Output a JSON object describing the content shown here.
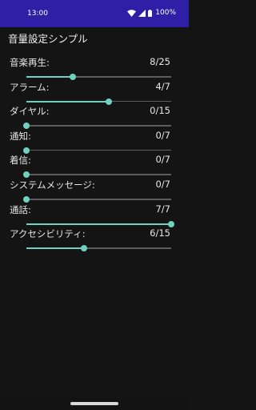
{
  "status_bar": {
    "time": "13:00",
    "battery": "100%",
    "icons": [
      "wifi-icon",
      "signal-icon",
      "battery-icon"
    ],
    "background": "#2e1fa6"
  },
  "app": {
    "title": "音量設定シンプル"
  },
  "accent_color": "#6fd1be",
  "volumes": [
    {
      "label": "音楽再生:",
      "value_text": "8/25",
      "current": 8,
      "max": 25
    },
    {
      "label": "アラーム:",
      "value_text": "4/7",
      "current": 4,
      "max": 7
    },
    {
      "label": "ダイヤル:",
      "value_text": "0/15",
      "current": 0,
      "max": 15
    },
    {
      "label": "通知:",
      "value_text": "0/7",
      "current": 0,
      "max": 7
    },
    {
      "label": "着信:",
      "value_text": "0/7",
      "current": 0,
      "max": 7
    },
    {
      "label": "システムメッセージ:",
      "value_text": "0/7",
      "current": 0,
      "max": 7
    },
    {
      "label": "通話:",
      "value_text": "7/7",
      "current": 7,
      "max": 7
    },
    {
      "label": "アクセシビリティ:",
      "value_text": "6/15",
      "current": 6,
      "max": 15
    }
  ]
}
